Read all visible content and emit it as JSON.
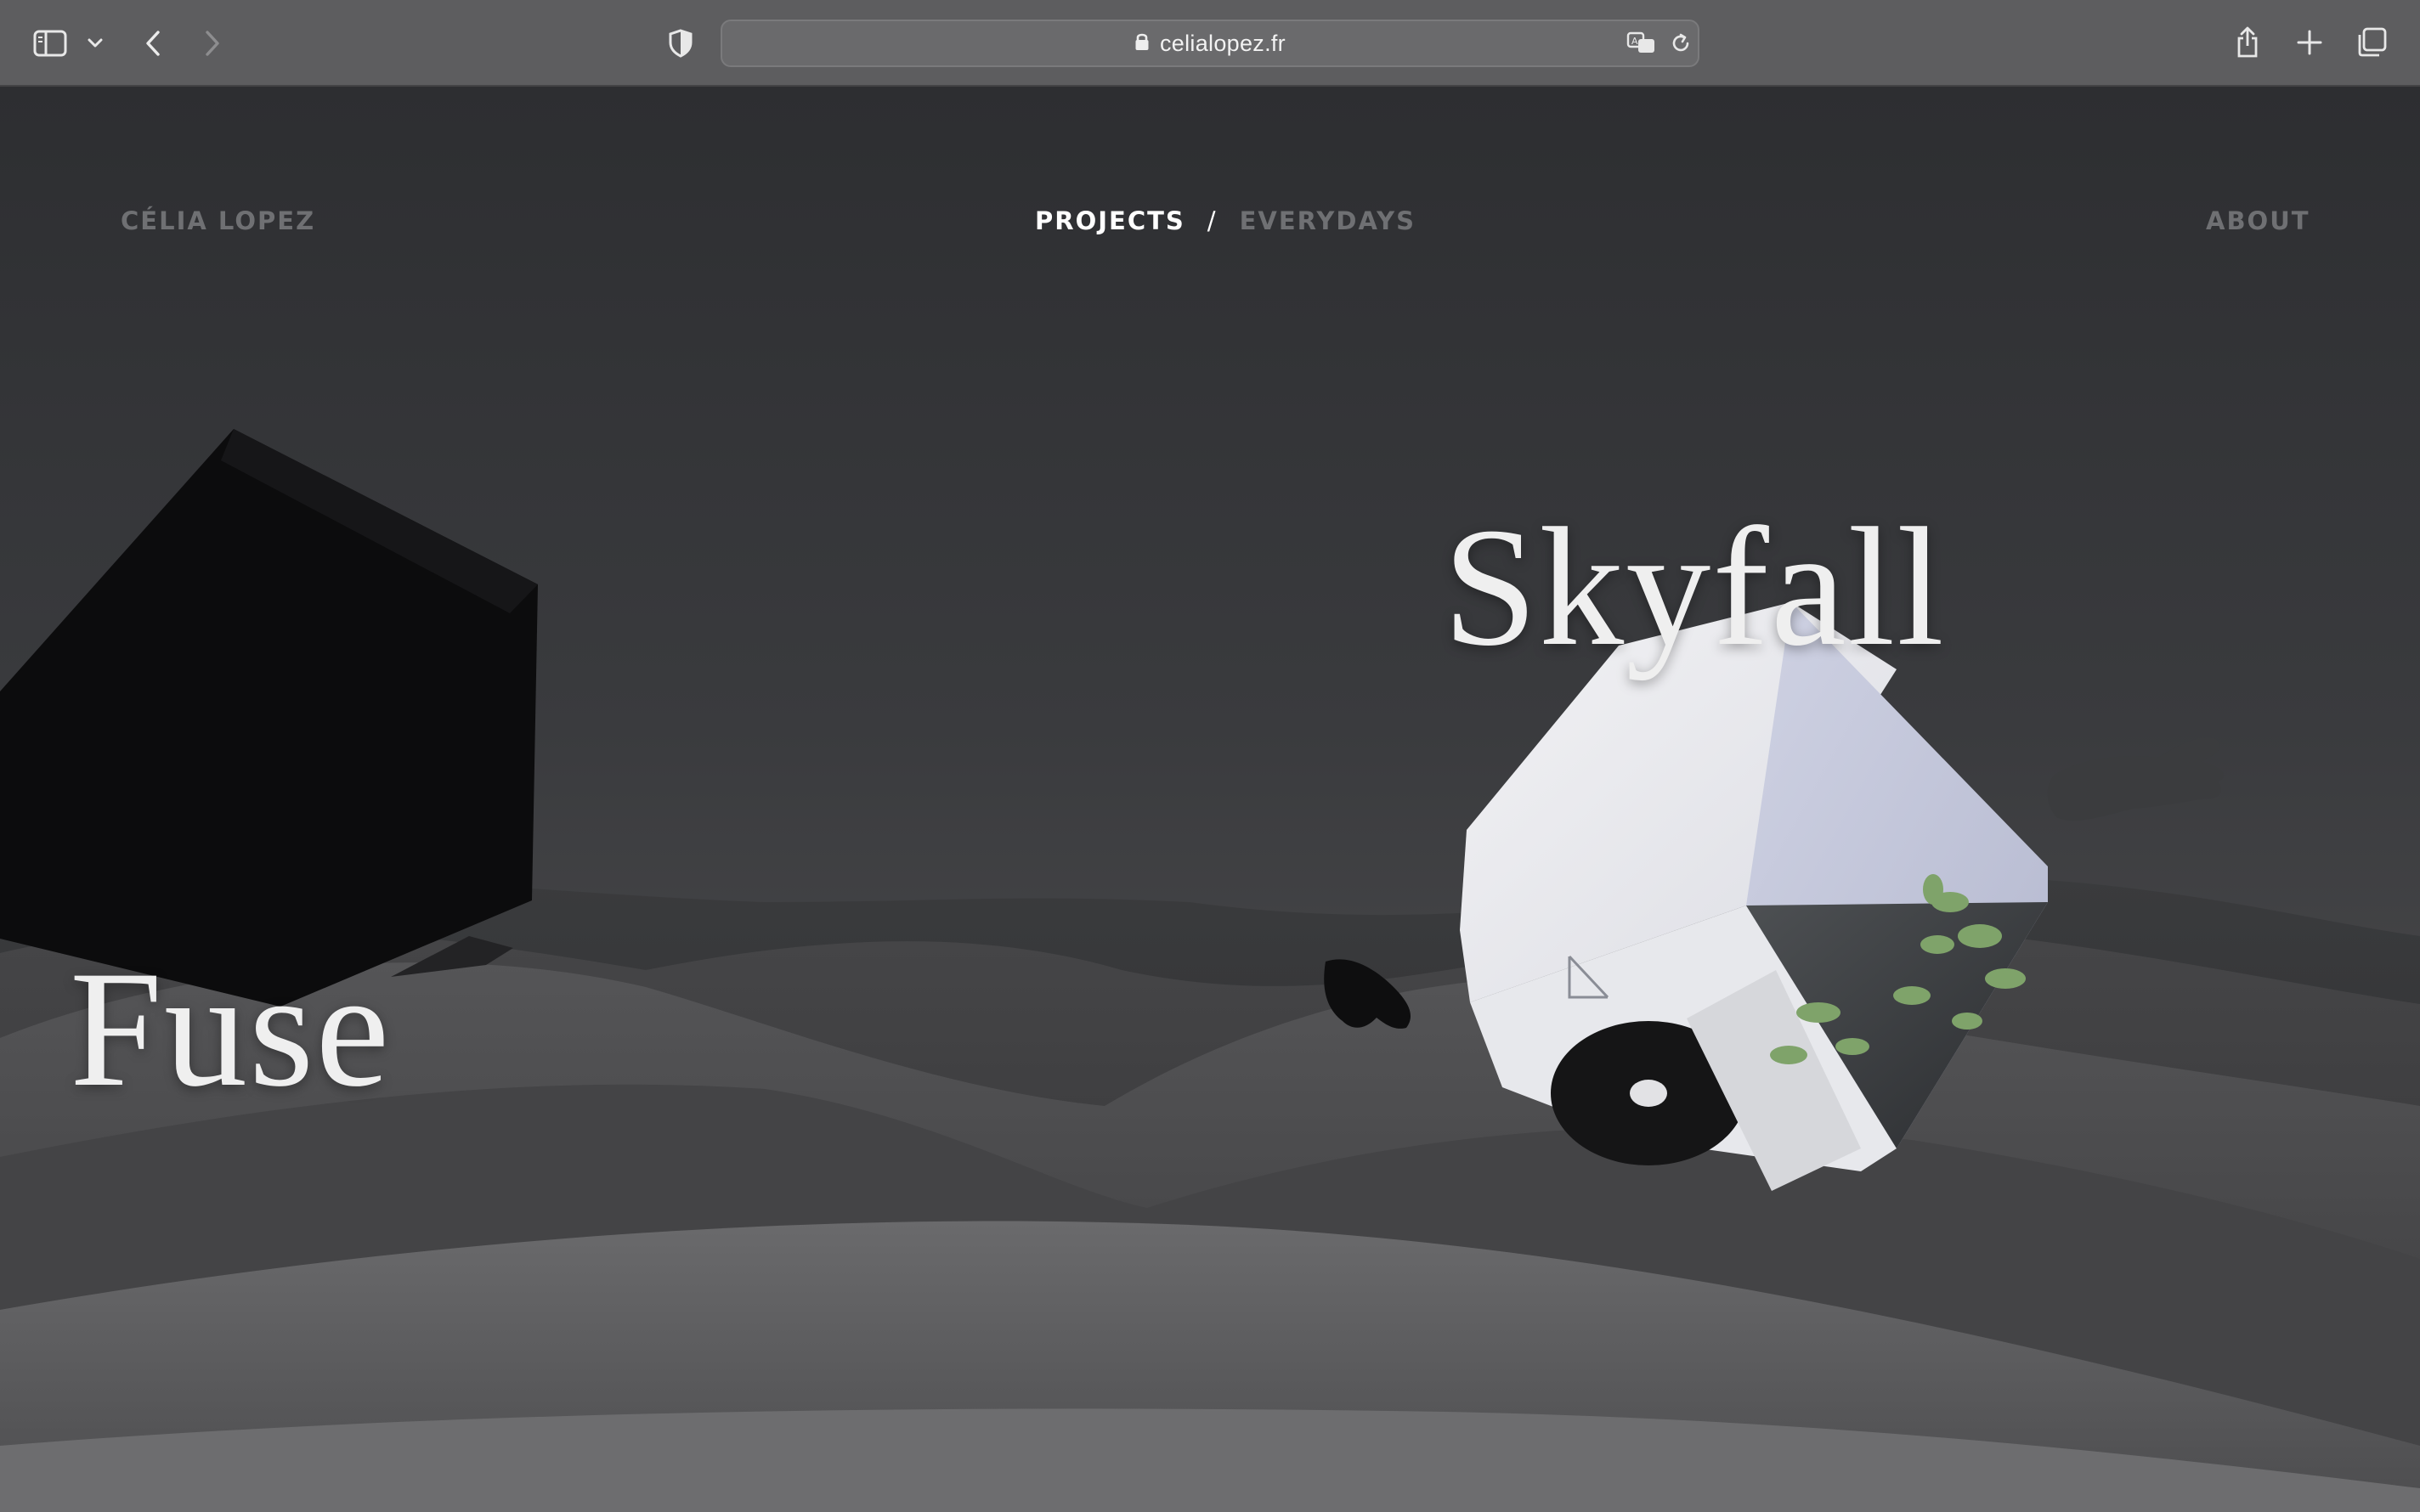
{
  "browser": {
    "url": "celialopez.fr",
    "icons": {
      "sidebar": "sidebar-icon",
      "sidebar_menu": "chevron-down-icon",
      "back": "chevron-left-icon",
      "forward": "chevron-right-icon",
      "privacy": "shield-icon",
      "lock": "lock-icon",
      "translate": "translate-icon",
      "reload": "reload-icon",
      "share": "share-icon",
      "new_tab": "plus-icon",
      "tab_overview": "tabs-icon"
    }
  },
  "site": {
    "brand": "CÉLIA LOPEZ",
    "nav": {
      "projects": "PROJECTS",
      "separator": "/",
      "everydays": "EVERYDAYS",
      "about": "ABOUT"
    },
    "projects": [
      {
        "title": "Skyfall"
      },
      {
        "title": "Fuse"
      }
    ]
  },
  "colors": {
    "toolbar": "#5d5d5f",
    "page_background": "#2f3033",
    "nav_active": "#ffffff",
    "nav_inactive": "#6f7073",
    "title": "#efefef"
  }
}
